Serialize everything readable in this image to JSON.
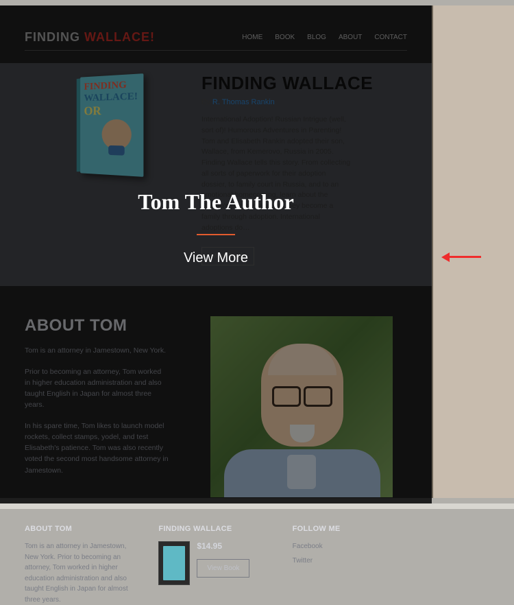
{
  "logo": {
    "part1": "FINDING",
    "part2": "WALLACE!"
  },
  "nav": {
    "home": "HOME",
    "book": "BOOK",
    "blog": "BLOG",
    "about": "ABOUT",
    "contact": "CONTACT"
  },
  "hero": {
    "title": "FINDING WALLACE",
    "by_prefix": "By ",
    "by_name": "R. Thomas Rankin",
    "text": "International Adoption! Russian Intrigue (well, sort of)! Humorous Adventures in Parenting! Tom and Elisabeth Rankin adopted their son, Wallace, from Kemerovo, Russia in 2005. Finding Wallace tells this story.  From collecting all sorts of paperwork for their adoption dossier, to family court in Russia, and to an emotional homecoming, learn about the Rankin's perseverance as they become a family through adoption. International adoptions do…",
    "btn": "View Book"
  },
  "book_cover": {
    "l1": "FINDING",
    "l2": "WALLACE!",
    "l3": "OR"
  },
  "about": {
    "title": "ABOUT TOM",
    "p1": "Tom is an attorney in Jamestown, New York.",
    "p2": "Prior to becoming an attorney, Tom worked in higher education administration and also taught English in Japan for almost three years.",
    "p3": "In his spare time, Tom likes to launch model rockets, collect stamps, yodel, and test Elisabeth's patience. Tom was also recently voted the second most handsome attorney in Jamestown."
  },
  "footer": {
    "about_h": "ABOUT TOM",
    "about_p": "Tom is an attorney in Jamestown, New York. Prior to becoming an attorney, Tom worked in higher education administration and also taught English in Japan for almost three years.",
    "book_h": "FINDING WALLACE",
    "price": "$14.95",
    "btn": "View Book",
    "follow_h": "FOLLOW ME",
    "facebook": "Facebook",
    "twitter": "Twitter"
  },
  "overlay": {
    "title": "Tom The Author",
    "more": "View More"
  }
}
